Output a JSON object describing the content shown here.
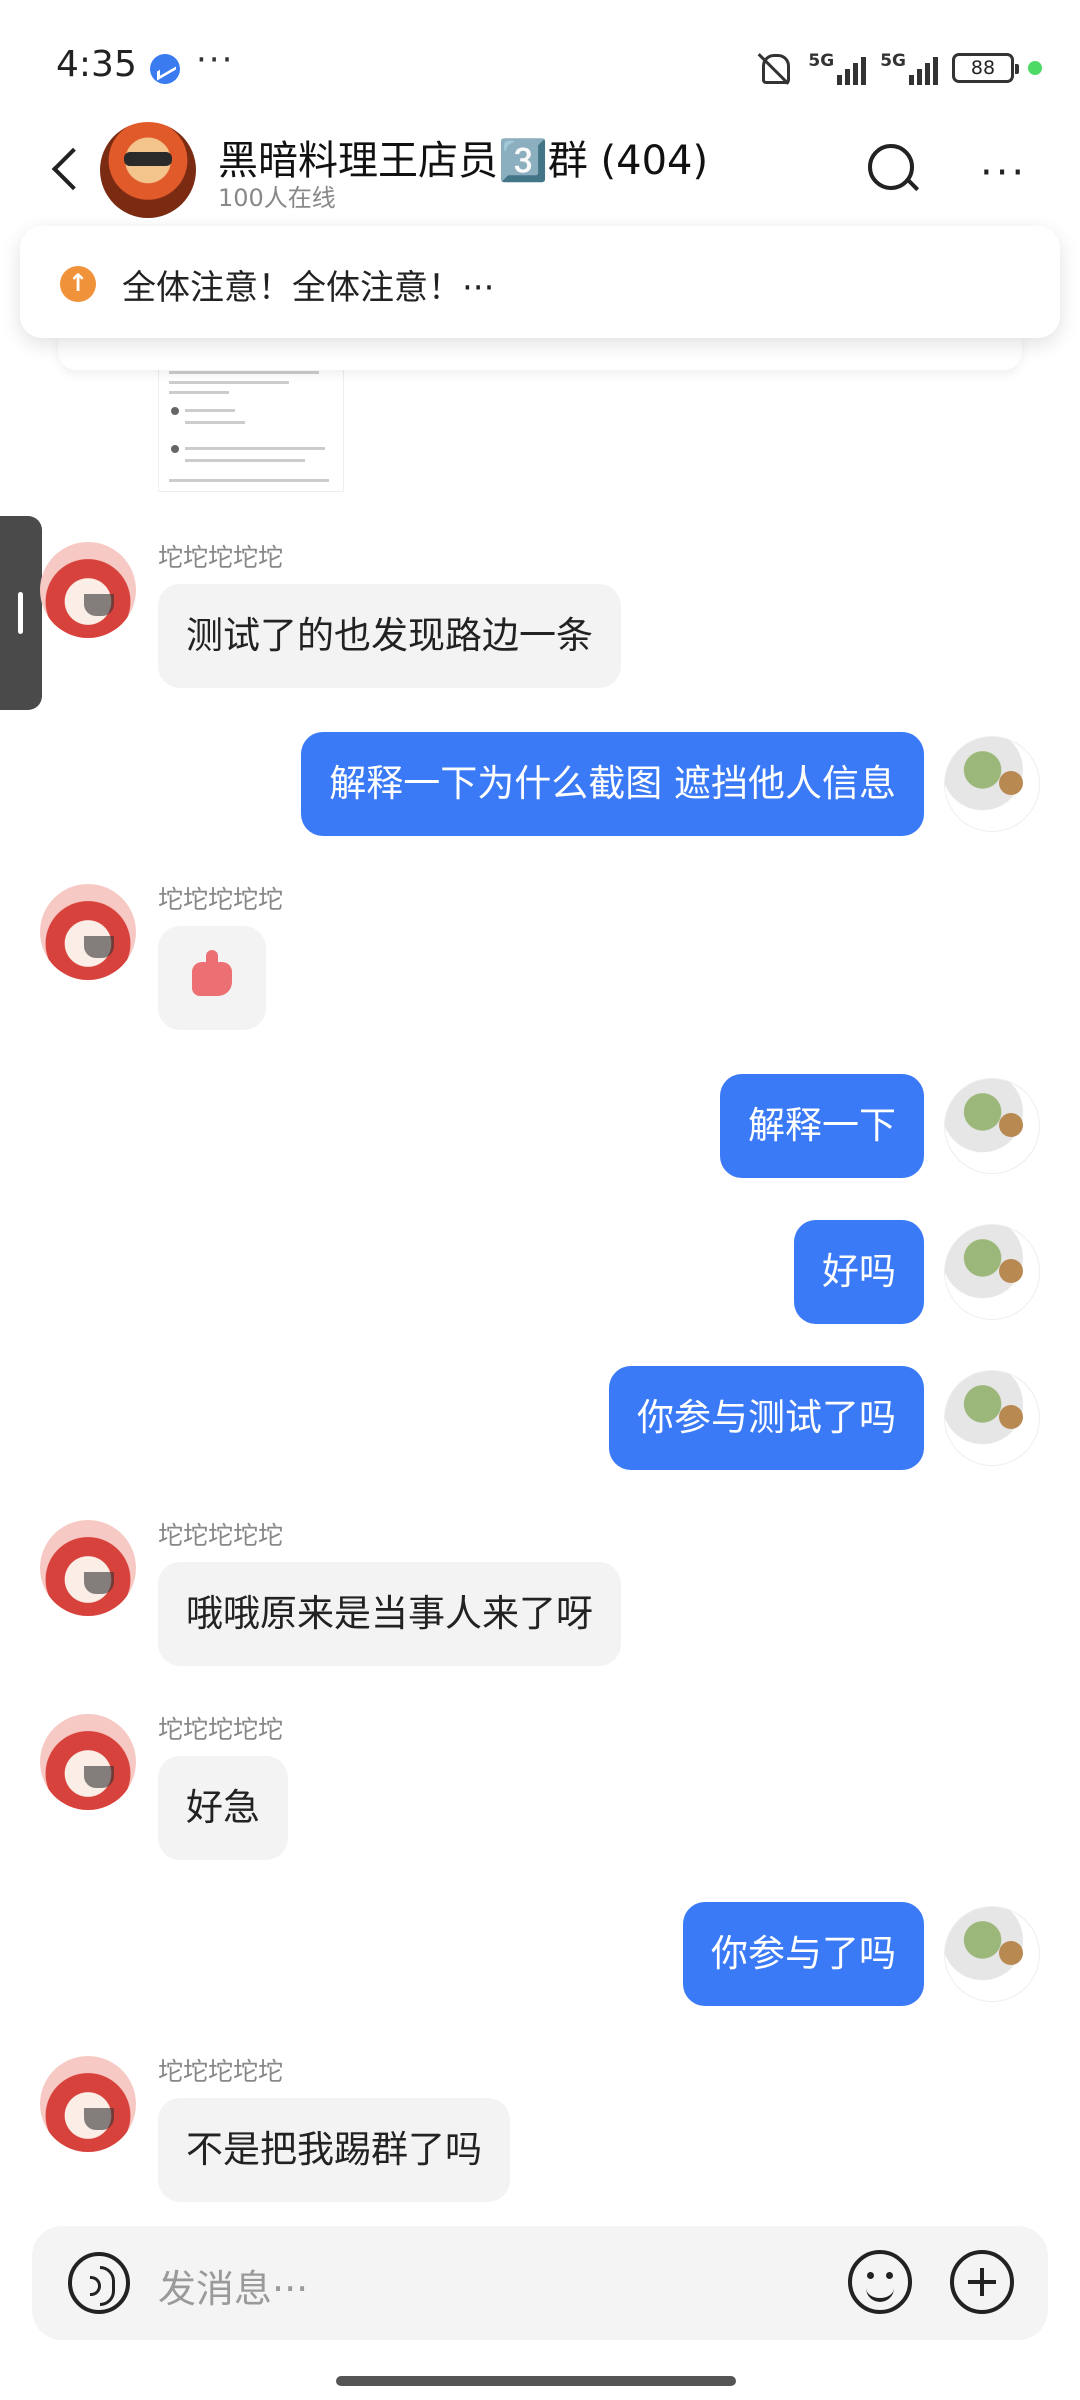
{
  "status_bar": {
    "time": "4:35",
    "overflow": "···",
    "network1": "5G",
    "network2": "5G",
    "battery": "88"
  },
  "header": {
    "title": "黑暗料理王店员3️⃣群 (404)",
    "subtitle": "100人在线"
  },
  "announcement": {
    "text": "全体注意！全体注意！···"
  },
  "input": {
    "placeholder": "发消息···"
  },
  "messages": [
    {
      "side": "in",
      "sender": "坨坨坨坨坨",
      "text": "测试了的也发现路边一条"
    },
    {
      "side": "out",
      "text": "解释一下为什么截图 遮挡他人信息"
    },
    {
      "side": "in",
      "sender": "坨坨坨坨坨",
      "text": "",
      "emoji": "thumbs-up-icon"
    },
    {
      "side": "out",
      "text": "解释一下"
    },
    {
      "side": "out",
      "text": "好吗"
    },
    {
      "side": "out",
      "text": "你参与测试了吗"
    },
    {
      "side": "in",
      "sender": "坨坨坨坨坨",
      "text": "哦哦原来是当事人来了呀"
    },
    {
      "side": "in",
      "sender": "坨坨坨坨坨",
      "text": "好急"
    },
    {
      "side": "out",
      "text": "你参与了吗"
    },
    {
      "side": "in",
      "sender": "坨坨坨坨坨",
      "text": "不是把我踢群了吗"
    }
  ],
  "colors": {
    "outgoing_bubble": "#3b7af6",
    "incoming_bubble": "#f3f3f3",
    "announcement_icon": "#f0923a"
  }
}
